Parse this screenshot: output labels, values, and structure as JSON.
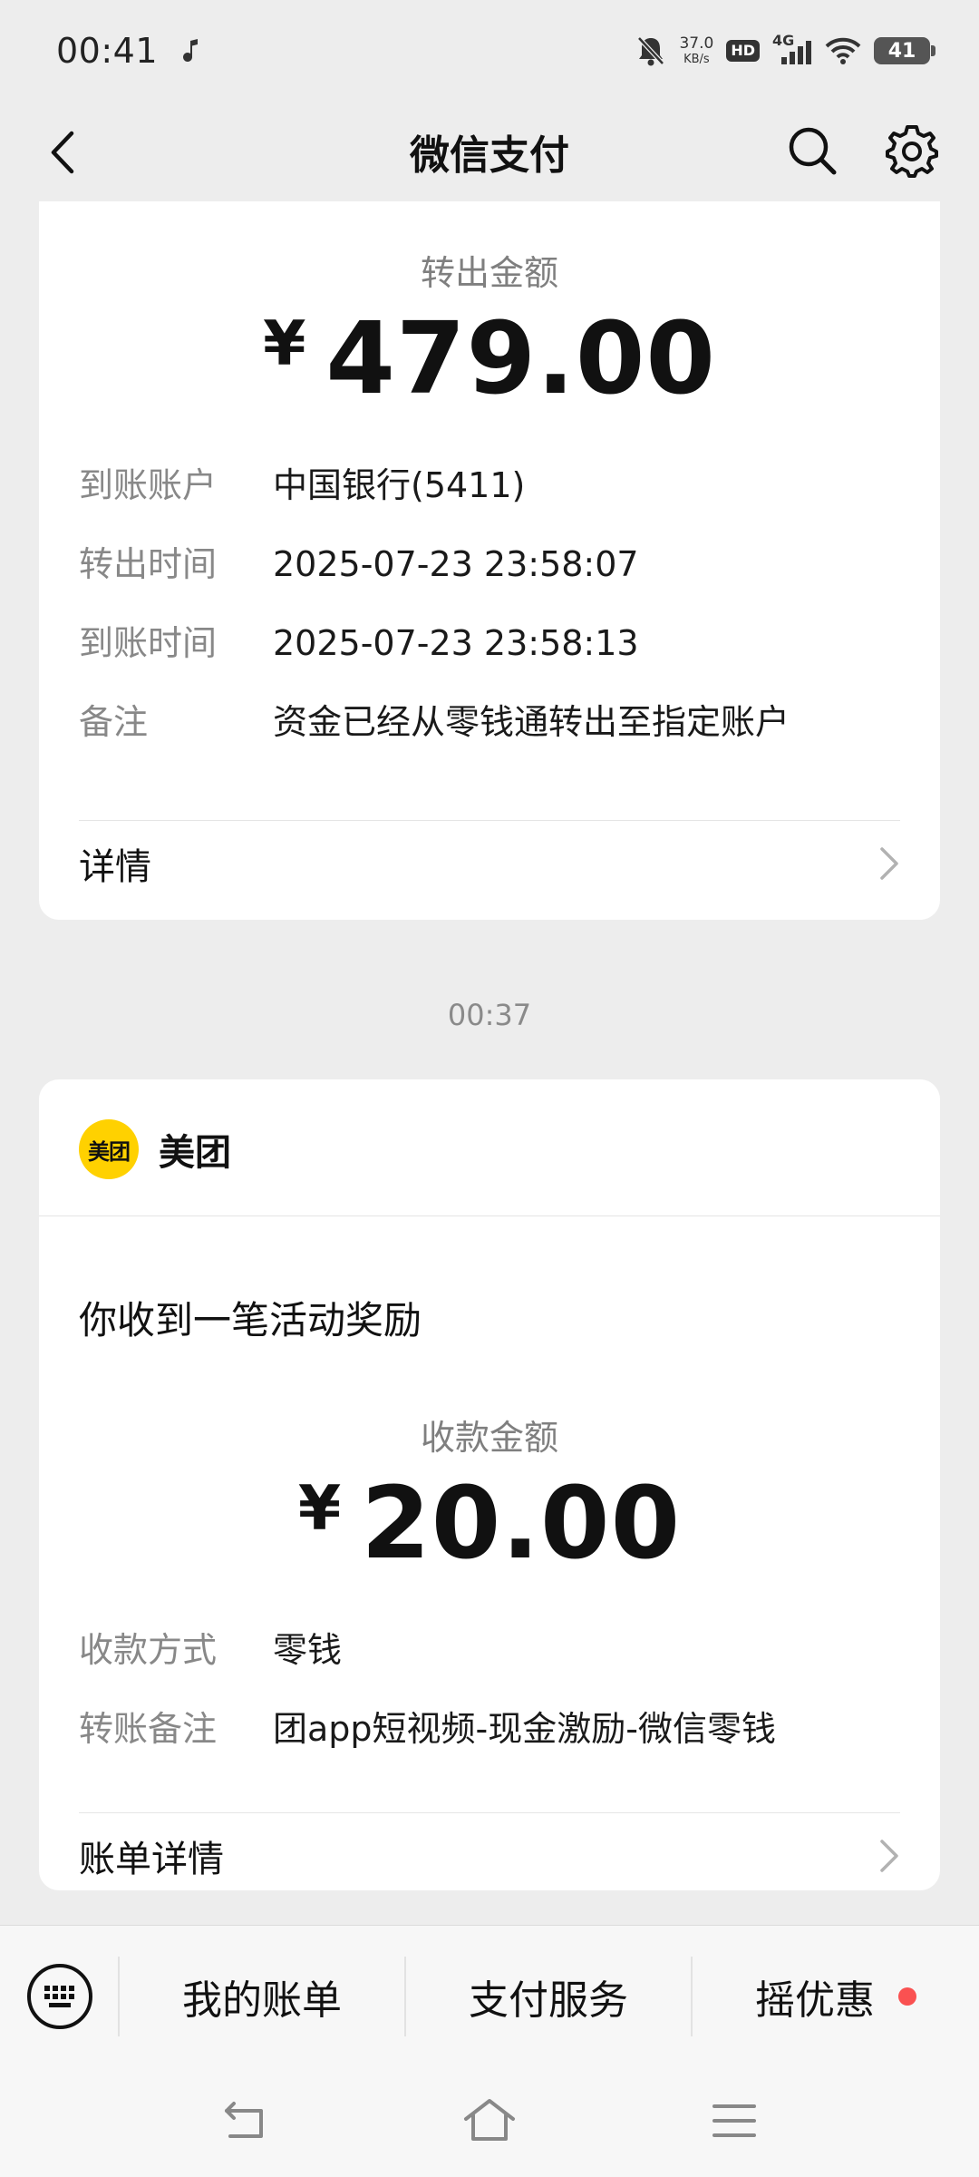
{
  "status_bar": {
    "time": "00:41",
    "net_speed_value": "37.0",
    "net_speed_unit": "KB/s",
    "hd": "HD",
    "network": "4G",
    "battery": "41"
  },
  "nav": {
    "title": "微信支付"
  },
  "card1": {
    "amount_label": "转出金额",
    "currency": "¥",
    "amount": "479.00",
    "rows": [
      {
        "key": "到账账户",
        "value": "中国银行(5411)"
      },
      {
        "key": "转出时间",
        "value": "2025-07-23  23:58:07"
      },
      {
        "key": "到账时间",
        "value": "2025-07-23  23:58:13"
      },
      {
        "key": "备注",
        "value": "资金已经从零钱通转出至指定账户"
      }
    ],
    "link_label": "详情"
  },
  "time_separator": "00:37",
  "card2": {
    "merchant_logo_text": "美团",
    "merchant_name": "美团",
    "notice_title": "你收到一笔活动奖励",
    "amount_label": "收款金额",
    "currency": "¥",
    "amount": "20.00",
    "rows": [
      {
        "key": "收款方式",
        "value": "零钱"
      },
      {
        "key": "转账备注",
        "value": "团app短视频-现金激励-微信零钱"
      }
    ],
    "link_label": "账单详情"
  },
  "toolbar": {
    "items": [
      "我的账单",
      "支付服务",
      "摇优惠"
    ]
  },
  "colors": {
    "background": "#EDEDED",
    "card": "#FFFFFF",
    "meituan_yellow": "#FFD100",
    "badge_red": "#FA5151"
  }
}
